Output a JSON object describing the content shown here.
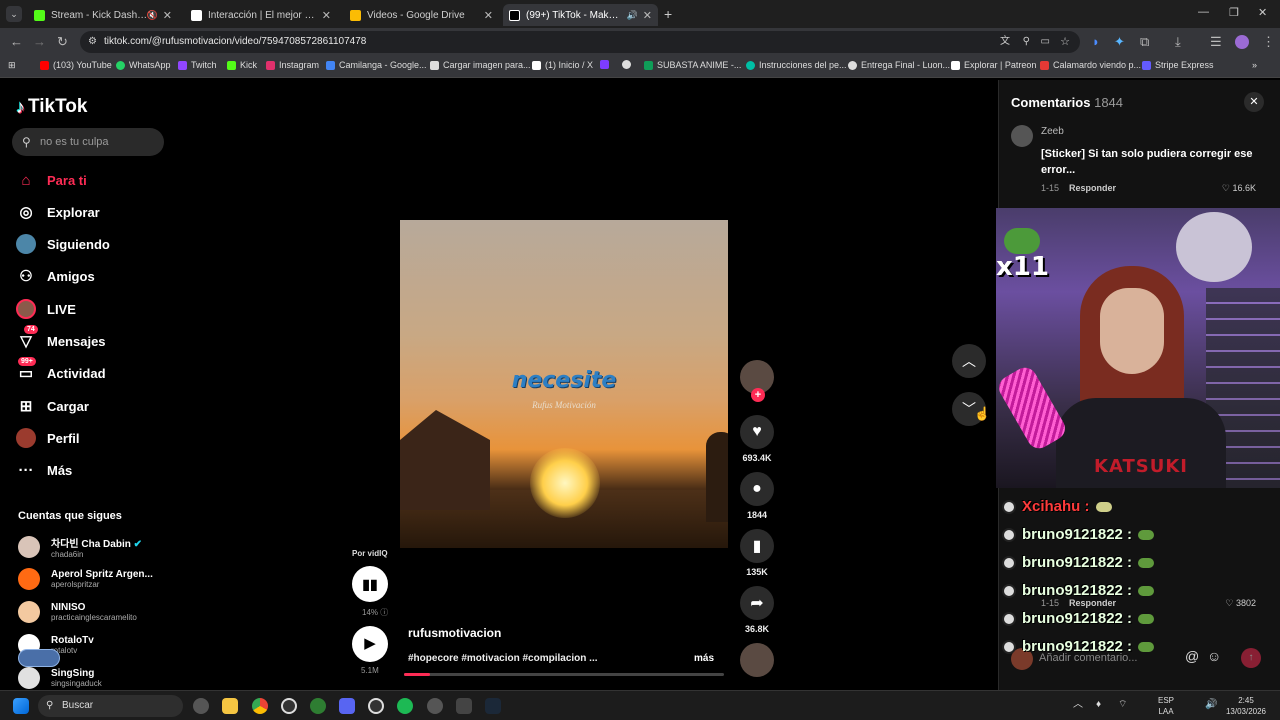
{
  "browser": {
    "tabs": [
      {
        "title": "Stream - Kick Dashboard",
        "color": "#53fc18"
      },
      {
        "title": "Interacción | El mejor software",
        "color": "#ffffff"
      },
      {
        "title": "Videos - Google Drive",
        "color": "#fbbc04"
      },
      {
        "title": "(99+) TikTok - Make Your Da",
        "color": "#ffffff"
      }
    ],
    "url": "tiktok.com/@rufusmotivacion/video/7594708572861107478",
    "bookmarks": [
      {
        "label": "(103) YouTube",
        "color": "#ff0000"
      },
      {
        "label": "WhatsApp",
        "color": "#25d366"
      },
      {
        "label": "Twitch",
        "color": "#9146ff"
      },
      {
        "label": "Kick",
        "color": "#53fc18"
      },
      {
        "label": "Instagram",
        "color": "#e1306c"
      },
      {
        "label": "Camilanga - Google...",
        "color": "#4285f4"
      },
      {
        "label": "Cargar imagen para...",
        "color": "#dddddd"
      },
      {
        "label": "(1) Inicio / X",
        "color": "#ffffff"
      },
      {
        "label": "",
        "color": "#7d3cff"
      },
      {
        "label": "",
        "color": "#dddddd"
      },
      {
        "label": "SUBASTA ANIME -...",
        "color": "#0f9d58"
      },
      {
        "label": "Instrucciones del pe...",
        "color": "#00bfa5"
      },
      {
        "label": "Entrega Final - Luon...",
        "color": "#dddddd"
      },
      {
        "label": "Explorar | Patreon",
        "color": "#ffffff"
      },
      {
        "label": "Calamardo viendo p...",
        "color": "#e53935"
      },
      {
        "label": "Stripe Express",
        "color": "#635bff"
      }
    ]
  },
  "tiktok": {
    "logo": "TikTok",
    "search_placeholder": "no es tu culpa",
    "nav": [
      {
        "label": "Para ti",
        "icon": "home-icon",
        "glyph": "⌂",
        "active": true
      },
      {
        "label": "Explorar",
        "icon": "compass-icon",
        "glyph": "◎"
      },
      {
        "label": "Siguiendo",
        "icon": "following-avatar-icon",
        "glyph": "●"
      },
      {
        "label": "Amigos",
        "icon": "friends-icon",
        "glyph": "⚇"
      },
      {
        "label": "LIVE",
        "icon": "live-icon",
        "glyph": "●"
      },
      {
        "label": "Mensajes",
        "icon": "messages-icon",
        "glyph": "▽",
        "badge": "74"
      },
      {
        "label": "Actividad",
        "icon": "activity-icon",
        "glyph": "▭",
        "badge": "99+"
      },
      {
        "label": "Cargar",
        "icon": "upload-icon",
        "glyph": "⊞"
      },
      {
        "label": "Perfil",
        "icon": "profile-avatar-icon",
        "glyph": "●"
      },
      {
        "label": "Más",
        "icon": "more-icon",
        "glyph": "···"
      }
    ],
    "following_title": "Cuentas que sigues",
    "following": [
      {
        "name": "차다빈 Cha Dabin",
        "handle": "chada6in",
        "color": "#d9c4b8",
        "verified": true
      },
      {
        "name": "Aperol Spritz Argen...",
        "handle": "aperolspritzar",
        "color": "#ff6a13"
      },
      {
        "name": "NINISO",
        "handle": "practicainglescaramelito",
        "color": "#f3c9a0"
      },
      {
        "name": "RotaloTv",
        "handle": "rotalotv",
        "color": "#ffffff"
      },
      {
        "name": "SingSing",
        "handle": "singsingaduck",
        "color": "#e0e0e0"
      }
    ]
  },
  "video": {
    "title_overlay": "necesite",
    "subtitle_overlay": "Rufus Motivación",
    "author": "rufusmotivacion",
    "description": "#hopecore #motivacion #compilacion ...",
    "more": "más",
    "progress": 0.08,
    "likes": "693.4K",
    "comments": "1844",
    "saves": "135K",
    "shares": "36.8K"
  },
  "vidiq": {
    "label": "Por vidIQ",
    "percent": "14%",
    "views": "5.1M"
  },
  "comments": {
    "title": "Comentarios",
    "count": "1844",
    "items": [
      {
        "user": "Zeeb",
        "text": "[Sticker] Si tan solo pudiera corregir ese error...",
        "date": "1-15",
        "reply": "Responder",
        "likes": "16.6K"
      },
      {
        "date": "1-15",
        "reply": "Responder",
        "likes": "3802"
      }
    ],
    "input_placeholder": "Añadir comentario..."
  },
  "stream": {
    "emote_count": "x11",
    "watermark": "KATSUKI",
    "chat": [
      {
        "user": "Xcihahu :",
        "color": "#ff3b3b"
      },
      {
        "user": "bruno9121822 :",
        "color": "#e8ffe0"
      },
      {
        "user": "bruno9121822 :",
        "color": "#e8ffe0"
      },
      {
        "user": "bruno9121822 :",
        "color": "#e8ffe0"
      },
      {
        "user": "bruno9121822 :",
        "color": "#e8ffe0"
      },
      {
        "user": "bruno9121822 :",
        "color": "#e8ffe0"
      }
    ]
  },
  "taskbar": {
    "search": "Buscar",
    "lang": "ESP",
    "lang2": "LAA",
    "time": "2:45",
    "date": "13/03/2026"
  }
}
